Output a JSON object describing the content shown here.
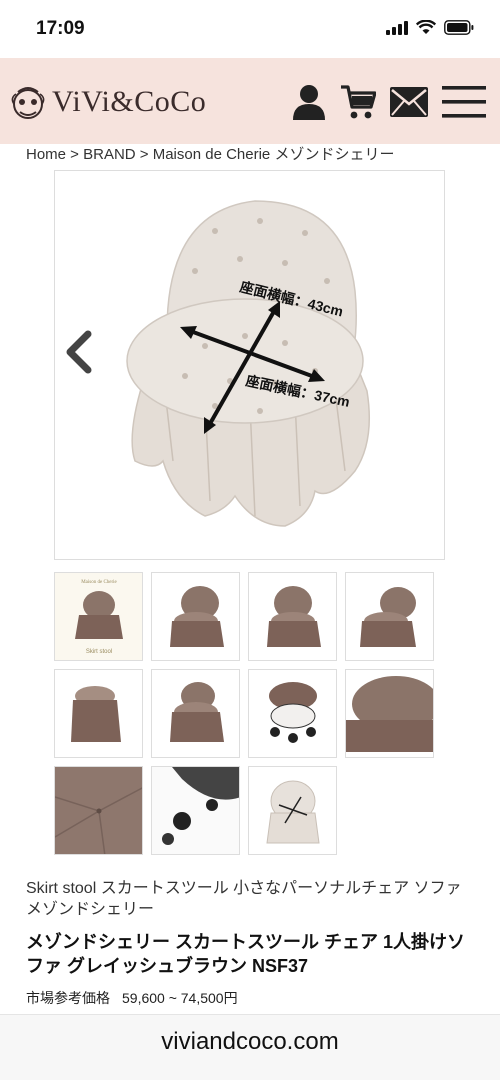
{
  "status_bar": {
    "time": "17:09"
  },
  "header": {
    "brand": "ViVi&CoCo",
    "background": "#f6e3dd"
  },
  "breadcrumb": "Home > BRAND > Maison de Cherie メゾンドシェリー",
  "main_image": {
    "annotations": {
      "seat_width": "座面横幅：43cm",
      "seat_depth": "座面横幅：37cm"
    }
  },
  "thumbnails": [
    {
      "type": "front-with-text",
      "caption_small": "Maison de Cherie",
      "caption": "Skirt stool"
    },
    {
      "type": "front"
    },
    {
      "type": "front"
    },
    {
      "type": "angled"
    },
    {
      "type": "side"
    },
    {
      "type": "front"
    },
    {
      "type": "underside"
    },
    {
      "type": "seat-closeup"
    },
    {
      "type": "fabric-closeup"
    },
    {
      "type": "casters"
    },
    {
      "type": "dimensions"
    }
  ],
  "product": {
    "description": "Skirt stool スカートスツール 小さなパーソナルチェア ソファ メゾンドシェリー",
    "title": "メゾンドシェリー スカートスツール チェア 1人掛けソファ グレイッシュブラウン NSF37",
    "price_label": "市場参考価格",
    "price_value": "59,600 ~ 74,500円"
  },
  "url_bar": {
    "url": "viviandcoco.com"
  }
}
